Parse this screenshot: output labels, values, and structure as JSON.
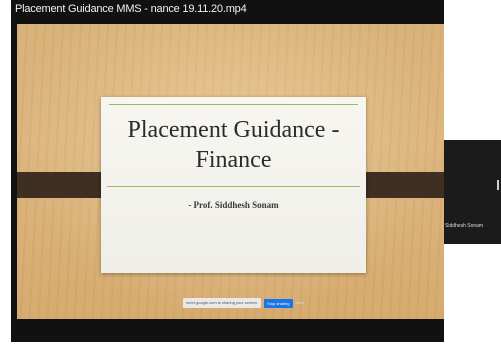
{
  "window": {
    "title": "Placement Guidance MMS - nance 19.11.20.mp4"
  },
  "slide": {
    "title": "Placement Guidance - Finance",
    "author": "- Prof. Siddhesh Sonam"
  },
  "screen_share": {
    "message": "meet.google.com is sharing your screen.",
    "stop_label": "Stop sharing",
    "hide_label": "Hide"
  },
  "participant": {
    "name": "Siddhesh Sonam"
  },
  "colors": {
    "wood": "#d9b27a",
    "band": "#3f2e22",
    "slide_rule": "#a4b46a",
    "stop_button": "#1a73e8"
  }
}
